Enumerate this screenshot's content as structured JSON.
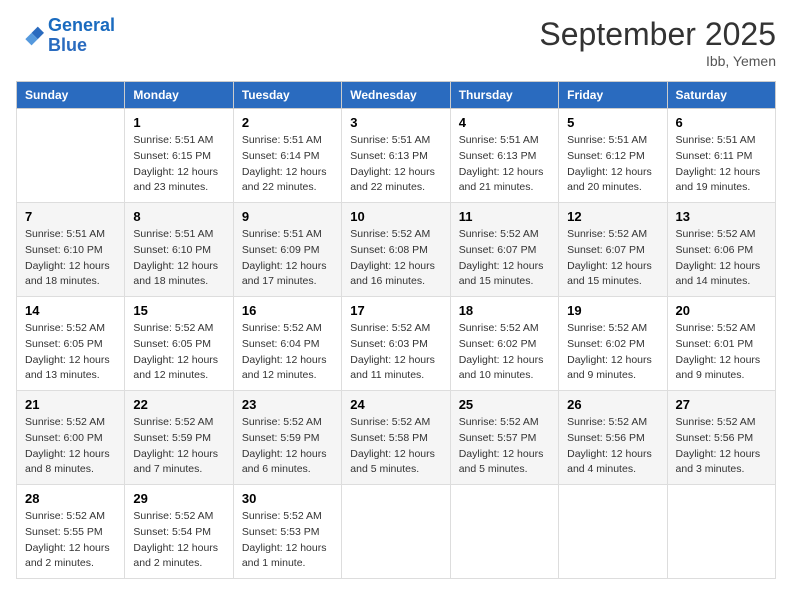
{
  "header": {
    "logo_line1": "General",
    "logo_line2": "Blue",
    "month": "September 2025",
    "location": "Ibb, Yemen"
  },
  "weekdays": [
    "Sunday",
    "Monday",
    "Tuesday",
    "Wednesday",
    "Thursday",
    "Friday",
    "Saturday"
  ],
  "weeks": [
    [
      {
        "day": "",
        "info": ""
      },
      {
        "day": "1",
        "info": "Sunrise: 5:51 AM\nSunset: 6:15 PM\nDaylight: 12 hours\nand 23 minutes."
      },
      {
        "day": "2",
        "info": "Sunrise: 5:51 AM\nSunset: 6:14 PM\nDaylight: 12 hours\nand 22 minutes."
      },
      {
        "day": "3",
        "info": "Sunrise: 5:51 AM\nSunset: 6:13 PM\nDaylight: 12 hours\nand 22 minutes."
      },
      {
        "day": "4",
        "info": "Sunrise: 5:51 AM\nSunset: 6:13 PM\nDaylight: 12 hours\nand 21 minutes."
      },
      {
        "day": "5",
        "info": "Sunrise: 5:51 AM\nSunset: 6:12 PM\nDaylight: 12 hours\nand 20 minutes."
      },
      {
        "day": "6",
        "info": "Sunrise: 5:51 AM\nSunset: 6:11 PM\nDaylight: 12 hours\nand 19 minutes."
      }
    ],
    [
      {
        "day": "7",
        "info": "Sunrise: 5:51 AM\nSunset: 6:10 PM\nDaylight: 12 hours\nand 18 minutes."
      },
      {
        "day": "8",
        "info": "Sunrise: 5:51 AM\nSunset: 6:10 PM\nDaylight: 12 hours\nand 18 minutes."
      },
      {
        "day": "9",
        "info": "Sunrise: 5:51 AM\nSunset: 6:09 PM\nDaylight: 12 hours\nand 17 minutes."
      },
      {
        "day": "10",
        "info": "Sunrise: 5:52 AM\nSunset: 6:08 PM\nDaylight: 12 hours\nand 16 minutes."
      },
      {
        "day": "11",
        "info": "Sunrise: 5:52 AM\nSunset: 6:07 PM\nDaylight: 12 hours\nand 15 minutes."
      },
      {
        "day": "12",
        "info": "Sunrise: 5:52 AM\nSunset: 6:07 PM\nDaylight: 12 hours\nand 15 minutes."
      },
      {
        "day": "13",
        "info": "Sunrise: 5:52 AM\nSunset: 6:06 PM\nDaylight: 12 hours\nand 14 minutes."
      }
    ],
    [
      {
        "day": "14",
        "info": "Sunrise: 5:52 AM\nSunset: 6:05 PM\nDaylight: 12 hours\nand 13 minutes."
      },
      {
        "day": "15",
        "info": "Sunrise: 5:52 AM\nSunset: 6:05 PM\nDaylight: 12 hours\nand 12 minutes."
      },
      {
        "day": "16",
        "info": "Sunrise: 5:52 AM\nSunset: 6:04 PM\nDaylight: 12 hours\nand 12 minutes."
      },
      {
        "day": "17",
        "info": "Sunrise: 5:52 AM\nSunset: 6:03 PM\nDaylight: 12 hours\nand 11 minutes."
      },
      {
        "day": "18",
        "info": "Sunrise: 5:52 AM\nSunset: 6:02 PM\nDaylight: 12 hours\nand 10 minutes."
      },
      {
        "day": "19",
        "info": "Sunrise: 5:52 AM\nSunset: 6:02 PM\nDaylight: 12 hours\nand 9 minutes."
      },
      {
        "day": "20",
        "info": "Sunrise: 5:52 AM\nSunset: 6:01 PM\nDaylight: 12 hours\nand 9 minutes."
      }
    ],
    [
      {
        "day": "21",
        "info": "Sunrise: 5:52 AM\nSunset: 6:00 PM\nDaylight: 12 hours\nand 8 minutes."
      },
      {
        "day": "22",
        "info": "Sunrise: 5:52 AM\nSunset: 5:59 PM\nDaylight: 12 hours\nand 7 minutes."
      },
      {
        "day": "23",
        "info": "Sunrise: 5:52 AM\nSunset: 5:59 PM\nDaylight: 12 hours\nand 6 minutes."
      },
      {
        "day": "24",
        "info": "Sunrise: 5:52 AM\nSunset: 5:58 PM\nDaylight: 12 hours\nand 5 minutes."
      },
      {
        "day": "25",
        "info": "Sunrise: 5:52 AM\nSunset: 5:57 PM\nDaylight: 12 hours\nand 5 minutes."
      },
      {
        "day": "26",
        "info": "Sunrise: 5:52 AM\nSunset: 5:56 PM\nDaylight: 12 hours\nand 4 minutes."
      },
      {
        "day": "27",
        "info": "Sunrise: 5:52 AM\nSunset: 5:56 PM\nDaylight: 12 hours\nand 3 minutes."
      }
    ],
    [
      {
        "day": "28",
        "info": "Sunrise: 5:52 AM\nSunset: 5:55 PM\nDaylight: 12 hours\nand 2 minutes."
      },
      {
        "day": "29",
        "info": "Sunrise: 5:52 AM\nSunset: 5:54 PM\nDaylight: 12 hours\nand 2 minutes."
      },
      {
        "day": "30",
        "info": "Sunrise: 5:52 AM\nSunset: 5:53 PM\nDaylight: 12 hours\nand 1 minute."
      },
      {
        "day": "",
        "info": ""
      },
      {
        "day": "",
        "info": ""
      },
      {
        "day": "",
        "info": ""
      },
      {
        "day": "",
        "info": ""
      }
    ]
  ]
}
